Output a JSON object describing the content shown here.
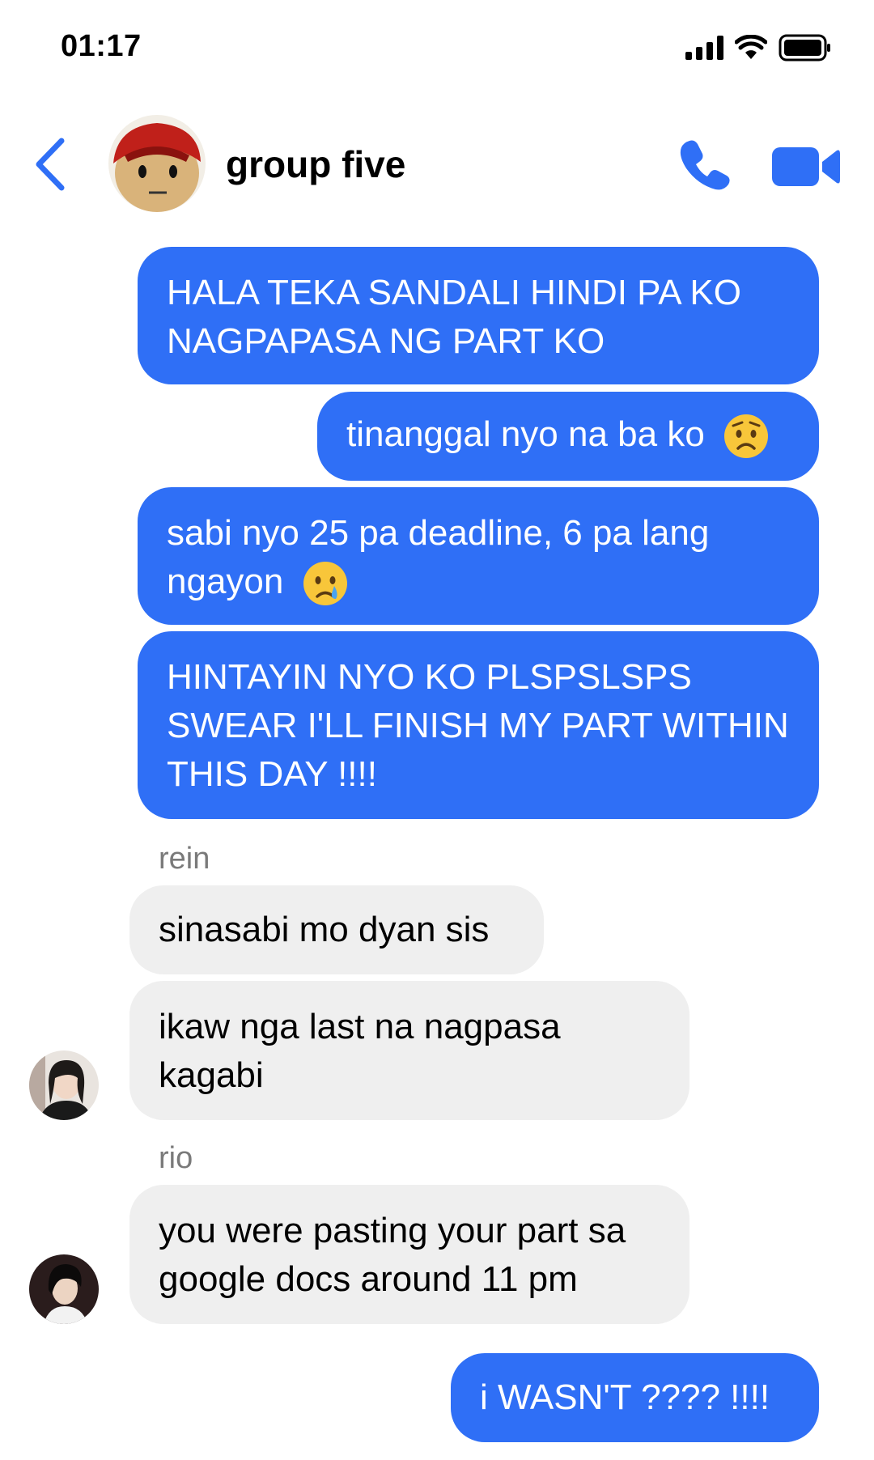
{
  "status_bar": {
    "time": "01:17"
  },
  "chat": {
    "title": "group five"
  },
  "messages": {
    "m1": "HALA TEKA SANDALI HINDI PA KO NAGPAPASA NG PART KO",
    "m2": "tinanggal nyo na ba ko",
    "m3": "sabi nyo 25 pa deadline, 6 pa lang ngayon",
    "m4": "HINTAYIN NYO KO PLSPSLSPS SWEAR I'LL FINISH MY PART WITHIN THIS DAY !!!!",
    "sender_rein": "rein",
    "m5": "sinasabi mo dyan sis",
    "m6": "ikaw nga last na nagpasa kagabi",
    "sender_rio": "rio",
    "m7": "you were pasting your part sa google docs around 11 pm",
    "m8": "i WASN'T ???? !!!!"
  },
  "colors": {
    "accent": "#2f6ff6",
    "incoming_bubble": "#efefef"
  },
  "icons": [
    "back-chevron-icon",
    "phone-icon",
    "video-camera-icon",
    "signal-icon",
    "wifi-icon",
    "battery-icon",
    "worried-face-emoji",
    "crying-face-emoji"
  ]
}
